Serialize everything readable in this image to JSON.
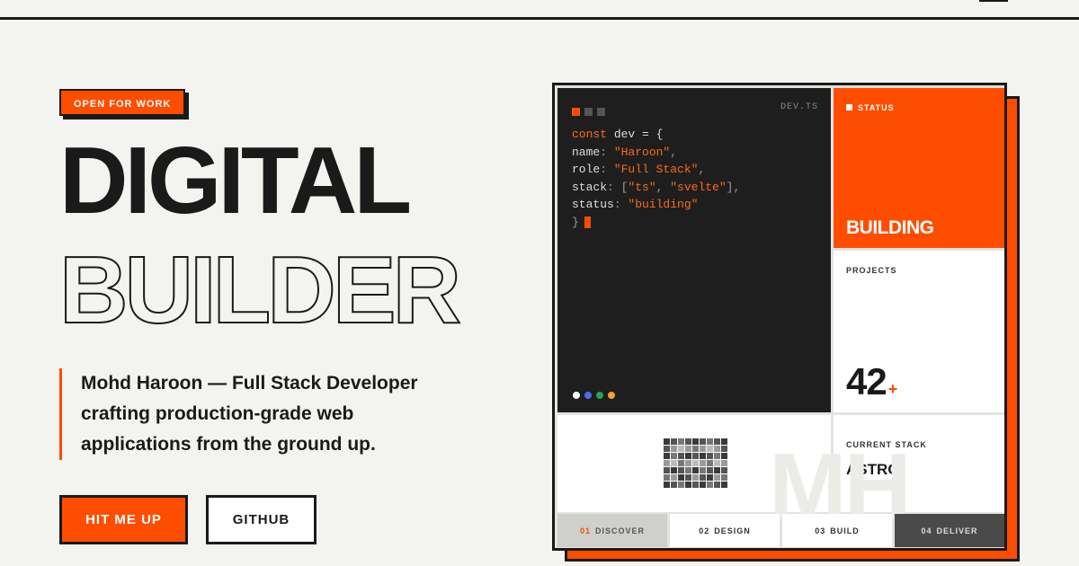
{
  "hero": {
    "badge": "OPEN FOR WORK",
    "title_line1": "DIGITAL",
    "title_line2": "BUILDER",
    "intro": [
      "Mohd Haroon — Full Stack Developer",
      "crafting production-grade web",
      "applications from the ground up."
    ],
    "cta_primary": "HIT ME UP",
    "cta_secondary": "GITHUB"
  },
  "card": {
    "file_name": "DEV.TS",
    "code": {
      "line1_kw": "const",
      "line1_rest": " dev = {",
      "name_key": "name",
      "name_val": "\"Haroon\"",
      "role_key": "role",
      "role_val": "\"Full Stack\"",
      "stack_key": "stack",
      "stack_val1": "\"ts\"",
      "stack_val2": "\"svelte\"",
      "status_key": "status",
      "status_val": "\"building\"",
      "close": "}"
    },
    "status_label": "STATUS",
    "status_value": "BUILDING",
    "projects_label": "PROJECTS",
    "projects_value": "42",
    "projects_suffix": "+",
    "stack_label": "CURRENT STACK",
    "stack_value": "ASTRO",
    "watermark": "MH",
    "steps": [
      {
        "num": "01",
        "label": "DISCOVER"
      },
      {
        "num": "02",
        "label": "DESIGN"
      },
      {
        "num": "03",
        "label": "BUILD"
      },
      {
        "num": "04",
        "label": "DELIVER"
      }
    ],
    "color_dots": [
      "#ffffff",
      "#4a6cf7",
      "#2e9e5b",
      "#f2a628"
    ]
  },
  "colors": {
    "accent": "#ff4d00",
    "ink": "#1a1a1a",
    "background": "#f3f3ef"
  }
}
